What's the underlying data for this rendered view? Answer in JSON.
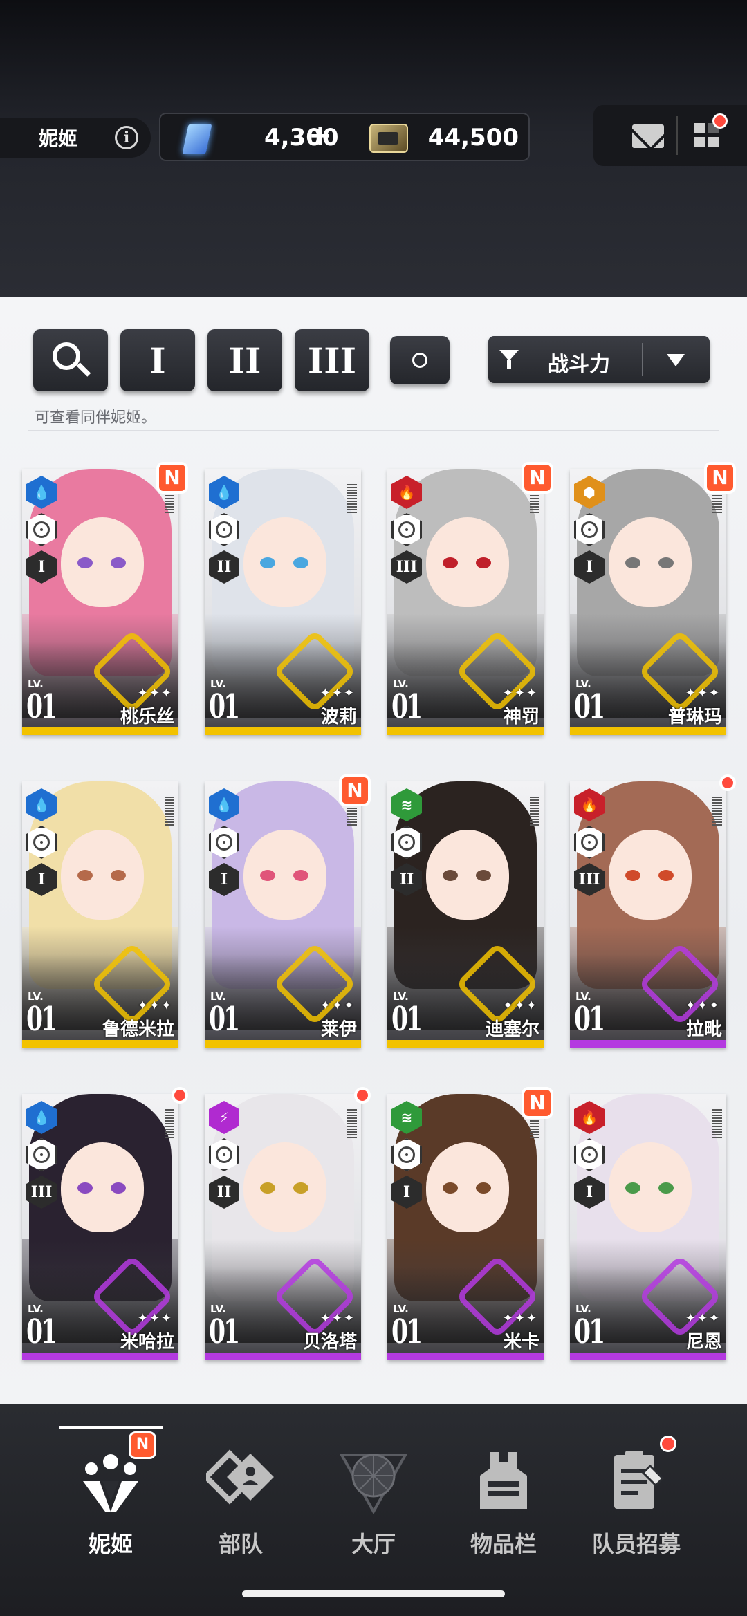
{
  "header": {
    "character_name": "妮姬",
    "info_icon": "info-icon",
    "gems": "4,300",
    "gems_plus": "+",
    "credits": "44,500",
    "mail_icon": "mail-icon",
    "menu_icon": "grid-menu-icon"
  },
  "filters": {
    "search_icon": "search-icon",
    "burst_1": "I",
    "burst_2": "II",
    "burst_3": "III",
    "circle_icon": "circle-icon",
    "sort_label": "战斗力",
    "hint": "可查看同伴妮姬。"
  },
  "cards": [
    {
      "name": "桃乐丝",
      "lv_label": "LV.",
      "level": "01",
      "element": "water",
      "burst": "I",
      "rarity": "gold",
      "badge": "N",
      "hair": "#e97aa0",
      "eyes": "#8a5ac8"
    },
    {
      "name": "波莉",
      "lv_label": "LV.",
      "level": "01",
      "element": "water",
      "burst": "II",
      "rarity": "gold",
      "badge": "",
      "hair": "#dfe3ea",
      "eyes": "#4aa7e0"
    },
    {
      "name": "神罚",
      "lv_label": "LV.",
      "level": "01",
      "element": "fire",
      "burst": "III",
      "rarity": "gold",
      "badge": "N",
      "hair": "#bdbdbd",
      "eyes": "#c0202a"
    },
    {
      "name": "普琳玛",
      "lv_label": "LV.",
      "level": "01",
      "element": "iron",
      "burst": "I",
      "rarity": "gold",
      "badge": "N",
      "hair": "#a7a7a7",
      "eyes": "#777"
    },
    {
      "name": "鲁德米拉",
      "lv_label": "LV.",
      "level": "01",
      "element": "water",
      "burst": "I",
      "rarity": "gold",
      "badge": "",
      "hair": "#f1dfa8",
      "eyes": "#b56a4a"
    },
    {
      "name": "莱伊",
      "lv_label": "LV.",
      "level": "01",
      "element": "water",
      "burst": "I",
      "rarity": "gold",
      "badge": "N",
      "hair": "#c9b8e6",
      "eyes": "#e0557a"
    },
    {
      "name": "迪塞尔",
      "lv_label": "LV.",
      "level": "01",
      "element": "wind",
      "burst": "II",
      "rarity": "gold",
      "badge": "",
      "hair": "#2b2320",
      "eyes": "#6a4a3a"
    },
    {
      "name": "拉毗",
      "lv_label": "LV.",
      "level": "01",
      "element": "fire",
      "burst": "III",
      "rarity": "purple",
      "badge": "dot",
      "hair": "#a36a55",
      "eyes": "#d04a2a"
    },
    {
      "name": "米哈拉",
      "lv_label": "LV.",
      "level": "01",
      "element": "water",
      "burst": "III",
      "rarity": "purple",
      "badge": "dot",
      "hair": "#2a2230",
      "eyes": "#8a4ac0"
    },
    {
      "name": "贝洛塔",
      "lv_label": "LV.",
      "level": "01",
      "element": "electric",
      "burst": "II",
      "rarity": "purple",
      "badge": "dot",
      "hair": "#e8e6ea",
      "eyes": "#c8a028"
    },
    {
      "name": "米卡",
      "lv_label": "LV.",
      "level": "01",
      "element": "wind",
      "burst": "I",
      "rarity": "purple",
      "badge": "N",
      "hair": "#5a3a28",
      "eyes": "#7a4a2a"
    },
    {
      "name": "尼恩",
      "lv_label": "LV.",
      "level": "01",
      "element": "fire",
      "burst": "I",
      "rarity": "purple",
      "badge": "",
      "hair": "#e8e0ec",
      "eyes": "#4a9a4a"
    }
  ],
  "element_colors": {
    "water": "#1f6fd1",
    "fire": "#c8202a",
    "iron": "#e0901a",
    "wind": "#2f9a3a",
    "electric": "#b02ad0"
  },
  "rarity_colors": {
    "gold": "#f2c200",
    "purple": "#b43ae0"
  },
  "nav": [
    {
      "label": "妮姬",
      "icon": "nikke-icon",
      "active": true,
      "badge": "N"
    },
    {
      "label": "部队",
      "icon": "squad-icon",
      "active": false,
      "badge": ""
    },
    {
      "label": "大厅",
      "icon": "lobby-icon",
      "active": false,
      "badge": ""
    },
    {
      "label": "物品栏",
      "icon": "inventory-icon",
      "active": false,
      "badge": ""
    },
    {
      "label": "队员招募",
      "icon": "recruit-icon",
      "active": false,
      "badge": "dot"
    }
  ]
}
